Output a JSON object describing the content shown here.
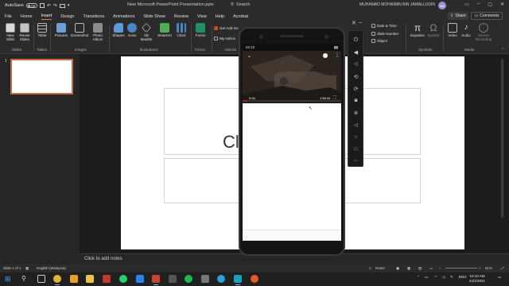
{
  "titlebar": {
    "autosave_label": "AutoSave",
    "autosave_state": "Off",
    "doc_title": "New Microsoft PowerPoint Presentation.pptx",
    "search_label": "Search",
    "user_name": "MUHAMAD MOHAIMIN BIN JAMALLUDIN",
    "user_initials": "MM"
  },
  "tabs": [
    "File",
    "Home",
    "Insert",
    "Design",
    "Transitions",
    "Animations",
    "Slide Show",
    "Review",
    "View",
    "Help",
    "Acrobat"
  ],
  "active_tab": "Insert",
  "share_label": "Share",
  "comments_label": "Comments",
  "ribbon": {
    "slides": {
      "new_slide": "New Slide",
      "reuse": "Reuse Slides",
      "group": "Slides"
    },
    "tables": {
      "table": "Table",
      "group": "Tables"
    },
    "images": {
      "pictures": "Pictures",
      "screenshot": "Screenshot",
      "photo_album": "Photo Album",
      "group": "Images"
    },
    "illustrations": {
      "shapes": "Shapes",
      "icons": "Icons",
      "models": "3D Models",
      "smartart": "SmartArt",
      "chart": "Chart",
      "group": "Illustrations"
    },
    "forms": {
      "forms": "Forms",
      "group": "Forms"
    },
    "addins": {
      "get": "Get Add-ins",
      "my": "My Add-in",
      "group": "Add-ins"
    },
    "text": {
      "date_time": "Date & Time",
      "slide_number": "Slide Number",
      "object": "Object"
    },
    "symbols": {
      "equation": "Equation",
      "symbol": "Symbol",
      "group": "Symbols"
    },
    "media": {
      "video": "Video",
      "audio": "Audio",
      "screen_recording": "Screen Recording",
      "group": "Media"
    }
  },
  "slide_pane": {
    "slide_number": "1"
  },
  "slide": {
    "title_text": "Cl"
  },
  "notes_placeholder": "Click to add notes",
  "status": {
    "slide_info": "Slide 1 of 1",
    "language": "English (Malaysia)",
    "notes": "Notes",
    "zoom": "61%"
  },
  "phone": {
    "time": "02:10",
    "video_elapsed": "0:04",
    "video_remaining": "1:56:44"
  },
  "taskbar": {
    "lang": "ENG",
    "time": "10:10 AM",
    "date": "24/1/2021"
  },
  "colors": {
    "accent": "#e4794d",
    "thumb_border": "#c8664a",
    "avatar": "#9a8ed6"
  }
}
